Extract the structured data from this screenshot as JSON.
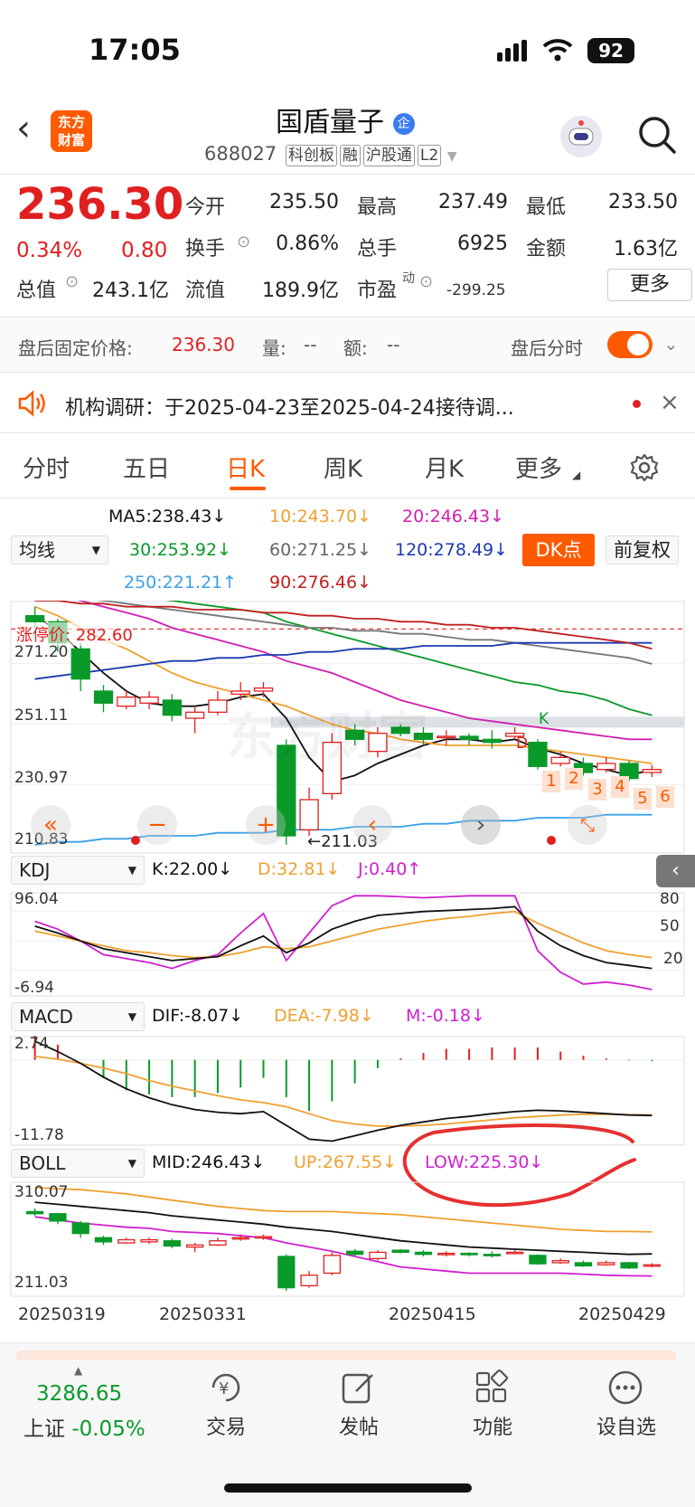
{
  "status": {
    "time": "17:05",
    "battery": "92"
  },
  "header": {
    "logo_text": "东方\n财富",
    "name": "国盾量子",
    "code": "688027",
    "tags": [
      "科创板",
      "融",
      "沪股通",
      "L2"
    ]
  },
  "quote": {
    "price": "236.30",
    "pct": "0.34%",
    "change": "0.80",
    "open_label": "今开",
    "open": "235.50",
    "high_label": "最高",
    "high": "237.49",
    "low_label": "最低",
    "low": "233.50",
    "turnover_label": "换手",
    "turnover": "0.86%",
    "volume_label": "总手",
    "volume": "6925",
    "amount_label": "金额",
    "amount": "1.63亿",
    "mktcap_label": "总值",
    "mktcap": "243.1亿",
    "float_label": "流值",
    "float": "189.9亿",
    "pe_label": "市盈",
    "pe_sup": "动",
    "pe": "-299.25",
    "more": "更多"
  },
  "after_hours": {
    "label": "盘后固定价格:",
    "price": "236.30",
    "vol_label": "量:",
    "vol": "--",
    "amt_label": "额:",
    "amt": "--",
    "toggle_label": "盘后分时"
  },
  "news": {
    "text": "机构调研：于2025-04-23至2025-04-24接待调..."
  },
  "tabs": [
    "分时",
    "五日",
    "日K",
    "周K",
    "月K",
    "更多"
  ],
  "ma": {
    "selector": "均线",
    "ma5": "MA5:238.43",
    "ma10": "10:243.70",
    "ma20": "20:246.43",
    "ma30": "30:253.92",
    "ma60": "60:271.25",
    "ma120": "120:278.49",
    "ma250": "250:221.21",
    "ma90": "90:276.46",
    "dk_button": "DK点",
    "adjust": "前复权"
  },
  "kline": {
    "limit_label": "涨停价:",
    "limit_price": "282.60",
    "y_labels": [
      "271.20",
      "251.11",
      "230.97",
      "210.83"
    ],
    "min_note": "←211.03",
    "buy_marks": [
      "1",
      "2",
      "3",
      "4",
      "5",
      "6"
    ],
    "k_mark": "K",
    "d_mark": "D",
    "watermark": "东方财富"
  },
  "kdj": {
    "selector": "KDJ",
    "k": "K:22.00",
    "d": "D:32.81",
    "j": "J:0.40",
    "y_max": "96.04",
    "y_min": "-6.94",
    "levels": [
      "80",
      "50",
      "20"
    ]
  },
  "macd": {
    "selector": "MACD",
    "dif": "DIF:-8.07",
    "dea": "DEA:-7.98",
    "m": "M:-0.18",
    "y_max": "2.74",
    "y_min": "-11.78"
  },
  "boll": {
    "selector": "BOLL",
    "mid": "MID:246.43",
    "up": "UP:267.55",
    "low": "LOW:225.30",
    "y_max": "310.07",
    "y_min": "211.03"
  },
  "dates": [
    "20250319",
    "20250331",
    "20250415",
    "20250429"
  ],
  "bottom": {
    "index_value": "3286.65",
    "index_name": "上证",
    "index_pct": "-0.05%",
    "trade": "交易",
    "post": "发帖",
    "func": "功能",
    "watch": "设自选"
  },
  "colors": {
    "up": "#e02020",
    "down": "#0a9a2a",
    "accent": "#ff5a00"
  },
  "chart_data": {
    "type": "candlestick",
    "candles": [
      {
        "o": 287,
        "c": 285,
        "h": 290,
        "l": 283
      },
      {
        "o": 285,
        "c": 278,
        "h": 286,
        "l": 275
      },
      {
        "o": 276,
        "c": 266,
        "h": 278,
        "l": 262
      },
      {
        "o": 262,
        "c": 258,
        "h": 264,
        "l": 255
      },
      {
        "o": 257,
        "c": 260,
        "h": 262,
        "l": 256
      },
      {
        "o": 258,
        "c": 260,
        "h": 262,
        "l": 256
      },
      {
        "o": 259,
        "c": 254,
        "h": 261,
        "l": 252
      },
      {
        "o": 253,
        "c": 255,
        "h": 257,
        "l": 248
      },
      {
        "o": 255,
        "c": 259,
        "h": 262,
        "l": 254
      },
      {
        "o": 261,
        "c": 262,
        "h": 265,
        "l": 259
      },
      {
        "o": 262,
        "c": 263,
        "h": 265,
        "l": 260
      },
      {
        "o": 244,
        "c": 214,
        "h": 246,
        "l": 211.03
      },
      {
        "o": 216,
        "c": 226,
        "h": 230,
        "l": 214
      },
      {
        "o": 228,
        "c": 245,
        "h": 248,
        "l": 226
      },
      {
        "o": 249,
        "c": 246,
        "h": 251,
        "l": 244
      },
      {
        "o": 242,
        "c": 248,
        "h": 250,
        "l": 240
      },
      {
        "o": 250,
        "c": 248,
        "h": 251,
        "l": 247
      },
      {
        "o": 248,
        "c": 246,
        "h": 250,
        "l": 244
      },
      {
        "o": 247,
        "c": 247,
        "h": 249,
        "l": 244
      },
      {
        "o": 247,
        "c": 246,
        "h": 248,
        "l": 244
      },
      {
        "o": 246,
        "c": 245,
        "h": 249,
        "l": 243
      },
      {
        "o": 247,
        "c": 248,
        "h": 250,
        "l": 246
      },
      {
        "o": 245,
        "c": 237,
        "h": 246,
        "l": 236
      },
      {
        "o": 238,
        "c": 240,
        "h": 242,
        "l": 237
      },
      {
        "o": 238,
        "c": 235,
        "h": 240,
        "l": 234
      },
      {
        "o": 236,
        "c": 238,
        "h": 240,
        "l": 235
      },
      {
        "o": 238,
        "c": 233,
        "h": 239,
        "l": 232
      },
      {
        "o": 235,
        "c": 236,
        "h": 237.49,
        "l": 233.5
      }
    ],
    "series": [
      {
        "name": "MA5",
        "values": [
          287,
          282,
          275,
          268,
          262,
          258,
          257,
          257,
          258,
          260,
          261,
          253,
          240,
          232,
          234,
          238,
          241,
          244,
          246,
          246,
          245,
          246,
          243,
          241,
          238,
          236,
          234,
          236
        ]
      },
      {
        "name": "10",
        "values": [
          290,
          287,
          283,
          279,
          276,
          272,
          268,
          265,
          263,
          261,
          259,
          257,
          254,
          251,
          249,
          248,
          246,
          245,
          244,
          244,
          244,
          244,
          243,
          242,
          241,
          240,
          239,
          238
        ]
      },
      {
        "name": "20",
        "values": [
          296,
          294,
          292,
          290,
          288,
          286,
          283,
          281,
          279,
          277,
          275,
          272,
          270,
          268,
          265,
          262,
          259,
          257,
          255,
          253,
          252,
          251,
          250,
          249,
          248,
          247,
          246,
          246
        ]
      },
      {
        "name": "30",
        "values": [
          298,
          297,
          296,
          295,
          294,
          293,
          292,
          291,
          290,
          289,
          288,
          285,
          283,
          281,
          279,
          277,
          275,
          273,
          271,
          269,
          267,
          265,
          264,
          262,
          261,
          259,
          256,
          254
        ]
      },
      {
        "name": "60",
        "values": [
          295,
          294,
          293,
          292,
          291,
          290,
          289,
          288,
          287,
          286,
          285,
          284,
          283,
          283,
          282,
          282,
          281,
          281,
          280,
          279,
          279,
          278,
          277,
          276,
          275,
          274,
          273,
          271
        ]
      },
      {
        "name": "120",
        "values": [
          266,
          267,
          268,
          269,
          270,
          271,
          272,
          272,
          273,
          273,
          274,
          274,
          275,
          275,
          276,
          276,
          276,
          277,
          277,
          277,
          277,
          278,
          278,
          278,
          278,
          278,
          278,
          278
        ]
      },
      {
        "name": "90",
        "values": [
          292,
          292,
          291,
          291,
          290,
          290,
          290,
          289,
          289,
          289,
          288,
          288,
          287,
          287,
          286,
          286,
          285,
          285,
          284,
          284,
          283,
          283,
          282,
          281,
          280,
          279,
          278,
          276
        ]
      },
      {
        "name": "250",
        "values": [
          211,
          212,
          212,
          213,
          213,
          214,
          214,
          214,
          215,
          215,
          215,
          216,
          216,
          216,
          217,
          217,
          217,
          218,
          218,
          219,
          219,
          219,
          220,
          220,
          220,
          221,
          221,
          221
        ]
      }
    ],
    "kdj": {
      "K": [
        65,
        58,
        50,
        42,
        38,
        34,
        30,
        32,
        34,
        45,
        55,
        38,
        48,
        62,
        70,
        76,
        78,
        80,
        81,
        82,
        83,
        85,
        60,
        45,
        35,
        28,
        25,
        22
      ],
      "D": [
        60,
        55,
        50,
        45,
        40,
        38,
        35,
        33,
        34,
        38,
        44,
        42,
        44,
        50,
        56,
        62,
        66,
        70,
        73,
        75,
        78,
        80,
        68,
        58,
        48,
        40,
        36,
        33
      ],
      "J": [
        70,
        62,
        50,
        36,
        32,
        28,
        22,
        30,
        36,
        58,
        78,
        30,
        58,
        86,
        96,
        96,
        95,
        94,
        95,
        96,
        96,
        96,
        40,
        18,
        6,
        8,
        5,
        0.4
      ]
    },
    "macd": {
      "DIF": [
        2.7,
        1.2,
        -0.5,
        -2.5,
        -4.2,
        -5.5,
        -6.5,
        -7.2,
        -7.6,
        -7.8,
        -7.5,
        -9.5,
        -11.5,
        -11.78,
        -11,
        -10.2,
        -9.5,
        -9,
        -8.5,
        -8.2,
        -7.8,
        -7.5,
        -7.3,
        -7.4,
        -7.6,
        -7.8,
        -8,
        -8.07
      ],
      "DEA": [
        0.5,
        0.1,
        -0.5,
        -1.2,
        -2,
        -3,
        -3.8,
        -4.5,
        -5.2,
        -5.8,
        -6.2,
        -6.8,
        -7.8,
        -8.8,
        -9.3,
        -9.6,
        -9.6,
        -9.5,
        -9.3,
        -9,
        -8.7,
        -8.4,
        -8.2,
        -8,
        -7.9,
        -7.9,
        -7.95,
        -7.98
      ],
      "M": [
        4.4,
        2.2,
        0,
        -2.6,
        -4.4,
        -5,
        -5.4,
        -5.4,
        -4.8,
        -4,
        -2.6,
        -5.4,
        -7.4,
        -6,
        -3.4,
        -1.2,
        0.2,
        1,
        1.6,
        1.6,
        1.8,
        1.8,
        1.8,
        1.2,
        0.6,
        0.2,
        -0.1,
        -0.18
      ]
    },
    "boll": {
      "UP": [
        310,
        309,
        308,
        306,
        304,
        301,
        298,
        295,
        292,
        290,
        288,
        287,
        287,
        287,
        286,
        285,
        284,
        282,
        280,
        278,
        276,
        274,
        272,
        270,
        269,
        268,
        268,
        267.55
      ],
      "MID": [
        296,
        294,
        292,
        290,
        288,
        286,
        283,
        281,
        279,
        277,
        275,
        272,
        270,
        268,
        265,
        262,
        259,
        257,
        255,
        253,
        252,
        251,
        250,
        249,
        248,
        247,
        246,
        246.43
      ],
      "LOW": [
        282,
        279,
        276,
        274,
        272,
        271,
        268,
        267,
        266,
        264,
        262,
        257,
        253,
        249,
        244,
        239,
        234,
        232,
        230,
        228,
        228,
        228,
        228,
        228,
        227,
        226,
        225.5,
        225.3
      ]
    }
  }
}
